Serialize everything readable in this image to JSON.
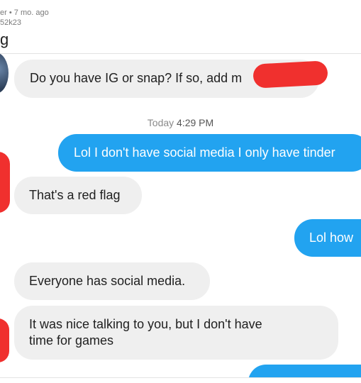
{
  "post": {
    "author_fragment": "er",
    "separator": "•",
    "age": "7 mo. ago",
    "sub_line": "52k23",
    "title_fragment": "g"
  },
  "chat": {
    "messages": [
      {
        "from": "them",
        "text": "Do you have IG or snap? If so, add m"
      },
      {
        "from": "me",
        "text": "Lol I don't have social media I only have tinder"
      },
      {
        "from": "them",
        "text": "That's a red flag"
      },
      {
        "from": "me",
        "text": "Lol how"
      },
      {
        "from": "them",
        "text": "Everyone has social media."
      },
      {
        "from": "them",
        "lines": [
          "It was nice talking to you, but I don't have",
          "time for games"
        ]
      }
    ],
    "timestamp": {
      "day": "Today",
      "time": "4:29 PM"
    }
  },
  "colors": {
    "sent_bubble": "#22a3f0",
    "received_bubble": "#efefef",
    "redaction": "#f0302e"
  }
}
